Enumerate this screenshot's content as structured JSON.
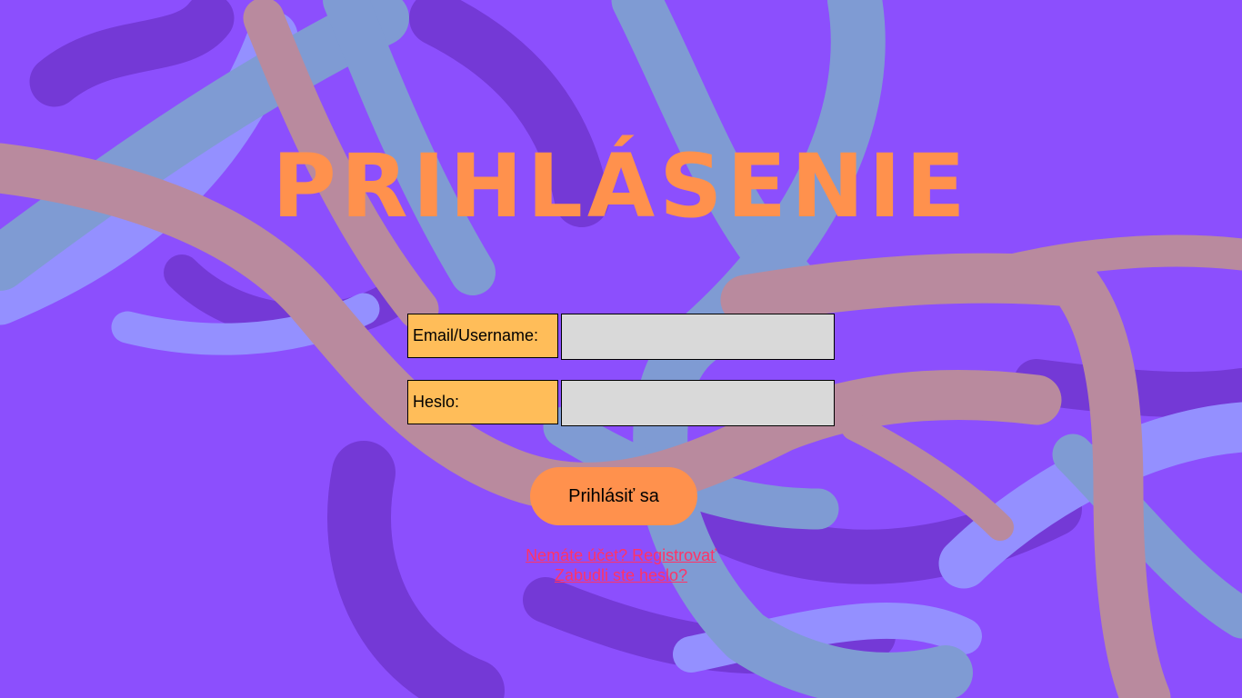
{
  "page": {
    "title": "PRIHLÁSENIE"
  },
  "form": {
    "email_label": "Email/Username:",
    "email_value": "",
    "password_label": "Heslo:",
    "password_value": "",
    "submit_label": "Prihlásiť sa"
  },
  "links": {
    "register": "Nemáte účet? Registrovať",
    "forgot": "Zabudli ste heslo?"
  },
  "colors": {
    "background": "#8c4ffd",
    "accent": "#ff914d",
    "label_bg": "#ffbd59",
    "input_bg": "#d9d9d9",
    "link": "#ff3366",
    "ribbon_pink": "#b98a9e",
    "ribbon_blue": "#7f9bd3",
    "ribbon_light": "#9490ff",
    "ribbon_dark": "#7439d6"
  }
}
